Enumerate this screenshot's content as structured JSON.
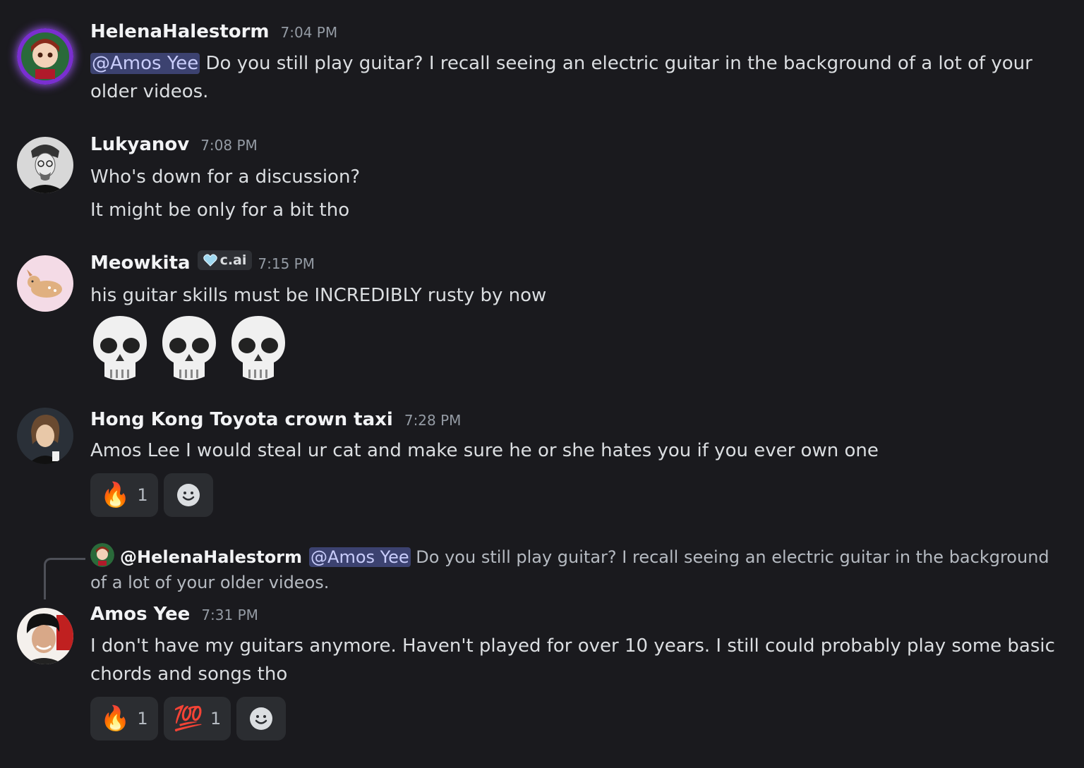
{
  "messages": [
    {
      "username": "HelenaHalestorm",
      "timestamp": "7:04 PM",
      "mention": "@Amos Yee",
      "text": "Do you still play guitar? I recall seeing an electric guitar in the background of a lot of your older videos."
    },
    {
      "username": "Lukyanov",
      "timestamp": "7:08 PM",
      "lines": [
        "Who's down for a discussion?",
        "It might be only for a bit tho"
      ]
    },
    {
      "username": "Meowkita",
      "badge": "c.ai",
      "timestamp": "7:15 PM",
      "text": "his guitar skills must be INCREDIBLY rusty by now",
      "big_emojis": [
        "skull",
        "skull",
        "skull"
      ]
    },
    {
      "username": "Hong Kong Toyota crown taxi",
      "timestamp": "7:28 PM",
      "text": "Amos Lee I would steal ur cat and make sure he or she hates you if you ever own one",
      "reactions": [
        {
          "emoji": "🔥",
          "count": "1"
        }
      ]
    },
    {
      "reply": {
        "username": "@HelenaHalestorm",
        "mention": "@Amos Yee",
        "text": "Do you still play guitar? I recall seeing an electric guitar in the background of a lot of your older videos."
      },
      "username": "Amos Yee",
      "timestamp": "7:31 PM",
      "text": "I don't have my guitars anymore. Haven't played for over 10 years. I still could probably play some basic chords and songs tho",
      "reactions": [
        {
          "emoji": "🔥",
          "count": "1"
        },
        {
          "emoji": "💯",
          "count": "1"
        }
      ]
    }
  ],
  "icons": {
    "add_reaction": "add-reaction-icon",
    "badge": "heart-badge-icon"
  },
  "colors": {
    "background": "#1a1a1e",
    "mention_bg": "#3c4270",
    "mention_text": "#c9cdfb",
    "username": "#f2f3f5",
    "timestamp": "#949ba4"
  }
}
